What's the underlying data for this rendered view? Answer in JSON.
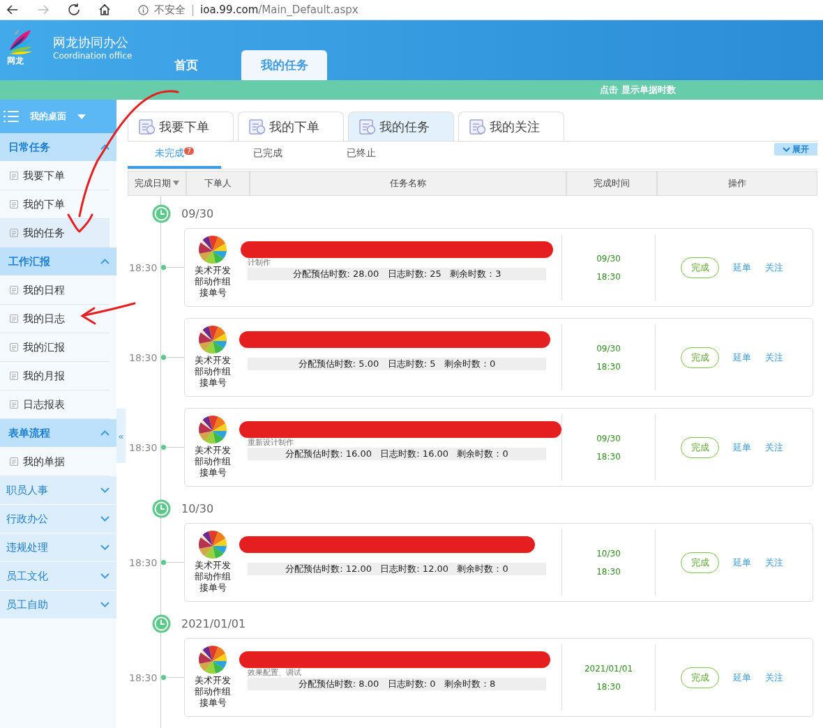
{
  "browser": {
    "security": "不安全",
    "separator": "|",
    "url_host": "ioa.99.com",
    "url_path": "/Main_Default.aspx"
  },
  "header": {
    "logo_text": "网龙",
    "title": "网龙协同办公",
    "subtitle": "Coordination office",
    "nav": [
      {
        "label": "首页",
        "selected": false
      },
      {
        "label": "我的任务",
        "selected": true
      }
    ]
  },
  "notice_bar": {
    "text": "点击 显示单据时数"
  },
  "sidebar": {
    "title": "我的桌面",
    "groups": [
      {
        "label": "日常任务",
        "expanded": true,
        "items": [
          {
            "label": "我要下单",
            "selected": false
          },
          {
            "label": "我的下单",
            "selected": false
          },
          {
            "label": "我的任务",
            "selected": true
          }
        ]
      },
      {
        "label": "工作汇报",
        "expanded": true,
        "items": [
          {
            "label": "我的日程",
            "selected": false
          },
          {
            "label": "我的日志",
            "selected": false
          },
          {
            "label": "我的汇报",
            "selected": false
          },
          {
            "label": "我的月报",
            "selected": false
          },
          {
            "label": "日志报表",
            "selected": false
          }
        ]
      },
      {
        "label": "表单流程",
        "expanded": true,
        "items": [
          {
            "label": "我的单据",
            "selected": false
          }
        ]
      },
      {
        "label": "职员人事",
        "expanded": false
      },
      {
        "label": "行政办公",
        "expanded": false
      },
      {
        "label": "违规处理",
        "expanded": false
      },
      {
        "label": "员工文化",
        "expanded": false
      },
      {
        "label": "员工自助",
        "expanded": false
      }
    ],
    "collapse_toggle": "«"
  },
  "module_tabs": [
    {
      "label": "我要下单",
      "selected": false
    },
    {
      "label": "我的下单",
      "selected": false
    },
    {
      "label": "我的任务",
      "selected": true
    },
    {
      "label": "我的关注",
      "selected": false
    }
  ],
  "status_tabs": [
    {
      "label": "未完成",
      "badge": "7",
      "selected": true
    },
    {
      "label": "已完成",
      "selected": false
    },
    {
      "label": "已终止",
      "selected": false
    }
  ],
  "expand_button": "展开",
  "table": {
    "columns": [
      "完成日期",
      "下单人",
      "任务名称",
      "完成时间",
      "操作"
    ],
    "groups": [
      {
        "date": "09/30",
        "rows": [
          {
            "time": "18:30",
            "orderer": "美术开发部动作组接单号",
            "title_redacted": true,
            "note": "计制作",
            "hours": "分配预估时数: 28.00   日志时数: 25   剩余时数：3",
            "due_date": "09/30",
            "due_time": "18:30",
            "actions": [
              "完成",
              "延单",
              "关注"
            ]
          },
          {
            "time": "18:30",
            "orderer": "美术开发部动作组接单号",
            "title_redacted": true,
            "hours": "分配预估时数: 5.00   日志时数: 5   剩余时数：0",
            "due_date": "09/30",
            "due_time": "18:30",
            "actions": [
              "完成",
              "延单",
              "关注"
            ]
          },
          {
            "time": "18:30",
            "orderer": "美术开发部动作组接单号",
            "title_redacted": true,
            "note": "重新设计制作",
            "hours": "分配预估时数: 16.00   日志时数: 16.00   剩余时数：0",
            "due_date": "09/30",
            "due_time": "18:30",
            "actions": [
              "完成",
              "延单",
              "关注"
            ]
          }
        ]
      },
      {
        "date": "10/30",
        "rows": [
          {
            "time": "18:30",
            "orderer": "美术开发部动作组接单号",
            "title_redacted": true,
            "hours": "分配预估时数: 12.00   日志时数: 12.00   剩余时数：0",
            "due_date": "10/30",
            "due_time": "18:30",
            "actions": [
              "完成",
              "延单",
              "关注"
            ]
          }
        ]
      },
      {
        "date": "2021/01/01",
        "rows": [
          {
            "time": "18:30",
            "orderer": "美术开发部动作组接单号",
            "title_redacted": true,
            "note": "效果配置、调试",
            "hours": "分配预估时数: 8.00   日志时数: 0   剩余时数：8",
            "due_date": "2021/01/01",
            "due_time": "18:30",
            "actions": [
              "完成",
              "延单",
              "关注"
            ]
          }
        ]
      }
    ]
  }
}
